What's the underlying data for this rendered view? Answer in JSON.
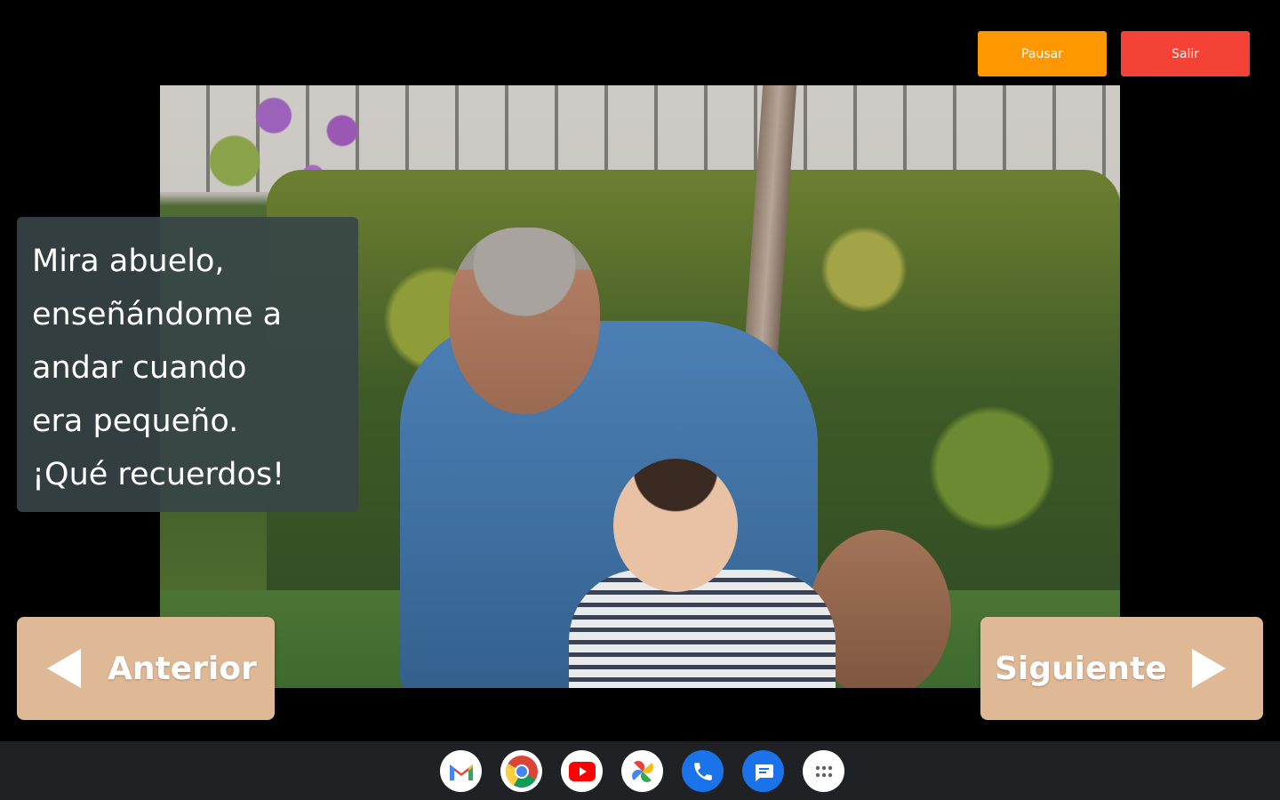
{
  "controls": {
    "pause_label": "Pausar",
    "exit_label": "Salir"
  },
  "caption": {
    "lines": [
      "Mira abuelo,",
      "enseñándome a",
      "andar cuando",
      "era pequeño.",
      "¡Qué recuerdos!"
    ]
  },
  "navigation": {
    "previous_label": "Anterior",
    "next_label": "Siguiente"
  },
  "shelf": {
    "apps": [
      "gmail-icon",
      "chrome-icon",
      "youtube-icon",
      "photos-icon",
      "phone-icon",
      "messages-icon",
      "launcher-icon"
    ]
  },
  "colors": {
    "pause": "#ff9800",
    "exit": "#f44336",
    "nav_button": "#dfb896",
    "caption_bg": "#374547"
  }
}
